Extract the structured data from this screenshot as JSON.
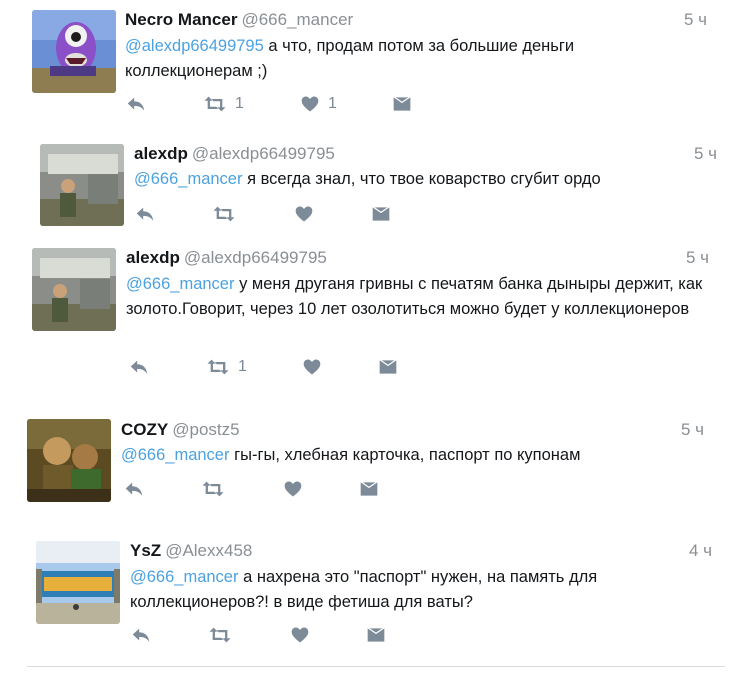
{
  "tweets": [
    {
      "name": "Necro Mancer",
      "handle": "@666_mancer",
      "time": "5 ч",
      "mention": "@alexdp66499795",
      "text": " а что, продам потом за большие деньги коллекционерам ;)",
      "retweets": "1",
      "likes": "1"
    },
    {
      "name": "alexdp",
      "handle": "@alexdp66499795",
      "time": "5 ч",
      "mention": "@666_mancer",
      "text": " я всегда знал, что твое коварство сгубит ордо",
      "retweets": "",
      "likes": ""
    },
    {
      "name": "alexdp",
      "handle": "@alexdp66499795",
      "time": "5 ч",
      "mention": "@666_mancer",
      "text": " у меня друганя гривны с печатям банка дыныры держит, как золото.Говорит, через 10 лет озолотиться можно будет у коллекционеров",
      "retweets": "1",
      "likes": ""
    },
    {
      "name": "COZY",
      "handle": "@postz5",
      "time": "5 ч",
      "mention": "@666_mancer",
      "text": " гы-гы, хлебная карточка, паспорт по купонам",
      "retweets": "",
      "likes": ""
    },
    {
      "name": "YsZ",
      "handle": "@Alexx458",
      "time": "4 ч",
      "mention": "@666_mancer",
      "text": " а нахрена это \"паспорт\"  нужен,  на память для коллекционеров?! в виде фетиша для ваты?",
      "retweets": "",
      "likes": ""
    }
  ],
  "icons": {
    "reply": "reply-icon",
    "retweet": "retweet-icon",
    "like": "heart-icon",
    "dm": "direct-message-icon"
  },
  "colors": {
    "mention": "#4ca2e0",
    "meta": "#8a8f94",
    "action": "#7d8a98"
  }
}
